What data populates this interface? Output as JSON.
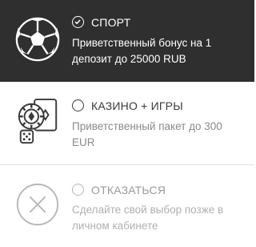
{
  "options": [
    {
      "title": "СПОРТ",
      "description": "Приветственный бонус на 1 депозит до 25000 RUB",
      "selected": true,
      "icon": "soccer-ball-icon"
    },
    {
      "title": "КАЗИНО + ИГРЫ",
      "description": "Приветственный пакет до 300 EUR",
      "selected": false,
      "icon": "casino-chips-cards-dice-icon"
    },
    {
      "title": "ОТКАЗАТЬСЯ",
      "description": "Сделайте свой выбор позже в личном кабинете",
      "selected": false,
      "icon": "close-circle-icon"
    }
  ],
  "colors": {
    "selected_background": "#2f2f2f",
    "selected_text": "#ffffff",
    "unselected_title": "#3a3a3a",
    "muted_text": "#9a9a9a",
    "divider": "#e2e2e2"
  }
}
